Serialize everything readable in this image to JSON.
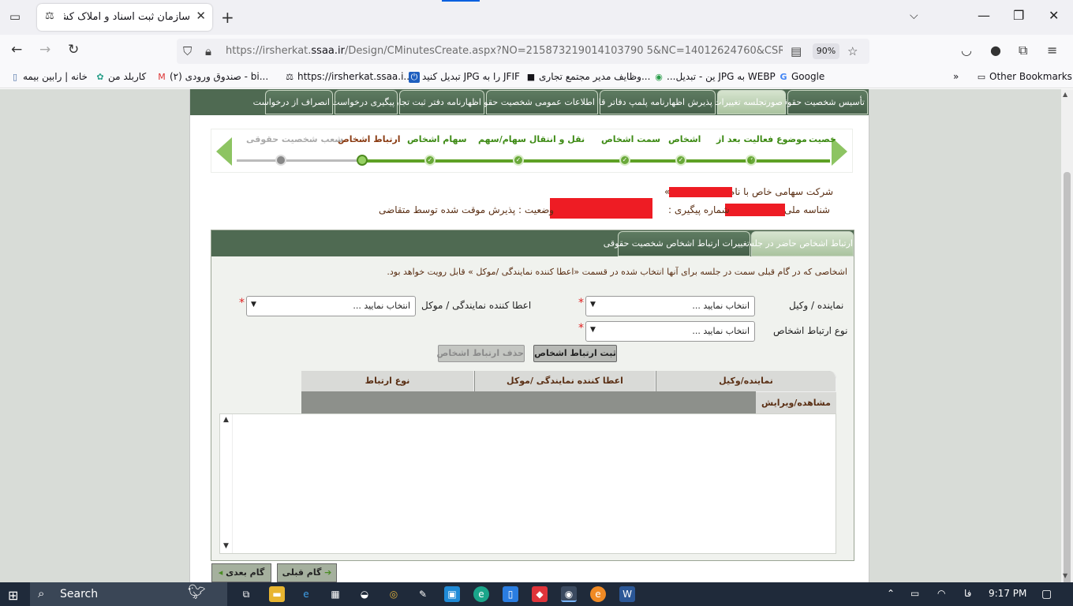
{
  "browser": {
    "tab_title": "سازمان ثبت اسناد و املاک کشور",
    "url_prefix": "https://irsherkat.",
    "url_domain": "ssaa.ir",
    "url_rest": "/Design/CMinutesCreate.aspx?NO=215873219014103790 5&NC=14012624760&CSRF=0a",
    "zoom": "90%",
    "bookmarks": [
      "خانه | رابین بیمه",
      "کاربلد من",
      "(۲) صندوق ورودی - bi...",
      "https://irsherkat.ssaa.i...",
      "تبدیل کنید JPG را به JFIF",
      "وظایف مدیر مجتمع تجاری...",
      "...ین - تبدیل JPG به WEBP",
      "Google"
    ],
    "other_bookmarks": "Other Bookmarks"
  },
  "menu": {
    "tabs": [
      "تأسیس شخصیت حقوقی",
      "صورتجلسه تغییرات",
      "پذیرش اظهارنامه پلمپ دفاتر قانونی",
      "اطلاعات عمومی شخصیت حقوقی",
      "اظهارنامه دفتر ثبت تجارتی",
      "پیگیری درخواست",
      "انصراف از درخواست"
    ]
  },
  "wizard": {
    "steps": [
      {
        "label": "خصیت",
        "state": "done"
      },
      {
        "label": "موضوع فعالیت بعد از",
        "state": "done"
      },
      {
        "label": "اشخاص",
        "state": "done"
      },
      {
        "label": "سمت اشخاص",
        "state": "done"
      },
      {
        "label": "نقل و انتقال سهام/سهم",
        "state": "done"
      },
      {
        "label": "سهام اشخاص",
        "state": "done"
      },
      {
        "label": "ارتباط اشخاص",
        "state": "current"
      },
      {
        "label": "شعب شخصیت حقوقی",
        "state": "pending"
      }
    ]
  },
  "company": {
    "name_line": "شرکت سهامی خاص با نام «",
    "name_close": "»",
    "national_id_label": "شناسه ملی :",
    "tracking_label": "شماره پیگیری :",
    "status": "وضعیت : پذیرش موقت شده توسط متقاضی"
  },
  "panel": {
    "tabs": [
      "ارتباط اشخاص حاضر در جلسه",
      "تغییرات ارتباط اشخاص شخصیت حقوقی"
    ],
    "hint": "اشخاصی که در گام قبلی سمت در جلسه برای آنها انتخاب شده در قسمت «اعطا کننده نمایندگی /موکل » قابل رویت خواهد بود.",
    "fields": {
      "representative_label": "نماینده / وکیل",
      "grantor_label": "اعطا کننده نمایندگی / موکل",
      "relation_type_label": "نوع ارتباط اشخاص",
      "select_placeholder": "انتخاب نمایید ..."
    },
    "buttons": {
      "register": "ثبت ارتباط اشخاص",
      "delete": "حذف ارتباط اشخاص"
    },
    "grid": {
      "headers": [
        "نماینده/وکیل",
        "اعطا کننده نمایندگی /موکل",
        "نوع ارتباط"
      ],
      "action_header": "مشاهده/ویرایش"
    }
  },
  "nav": {
    "prev": "گام قبلی",
    "next": "گام بعدی"
  },
  "taskbar": {
    "search": "Search",
    "lang": "فا",
    "time": "9:17 PM"
  }
}
